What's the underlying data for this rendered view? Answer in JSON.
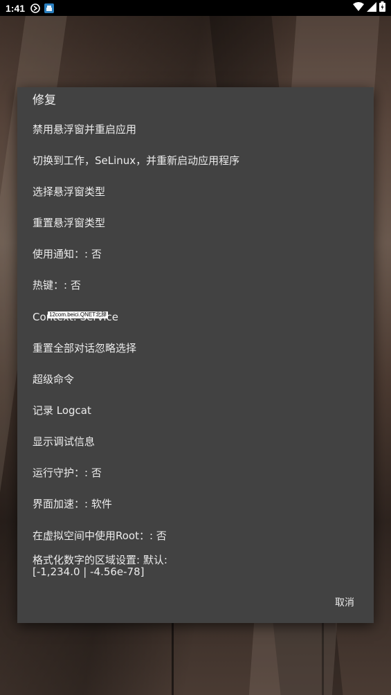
{
  "status_bar": {
    "time": "1:41"
  },
  "dialog": {
    "title": "修复",
    "items": [
      "禁用悬浮窗并重启应用",
      "切换到工作，SeLinux，并重新启动应用程序",
      "选择悬浮窗类型",
      "重置悬浮窗类型",
      "使用通知：: 否",
      "热键：: 否",
      "Context: Service",
      "重置全部对话忽略选择",
      "超级命令",
      "记录 Logcat",
      "显示调试信息",
      "运行守护：: 否",
      "界面加速：: 软件",
      "在虚拟空间中使用Root：: 否"
    ],
    "number_format": {
      "line1": "格式化数字的区域设置: 默认:",
      "line2": "[-1,234.0 | -4.56e-78]"
    },
    "cancel_label": "取消"
  },
  "watermark": "12com.beici.QNET北辞",
  "colors": {
    "dialog_bg": "#424242",
    "text": "#ececec",
    "status_bar_bg": "#000000"
  },
  "icons": {
    "status_left": [
      "notification-icon",
      "app-icon"
    ],
    "status_right": [
      "wifi-icon",
      "signal-icon",
      "battery-icon"
    ]
  }
}
